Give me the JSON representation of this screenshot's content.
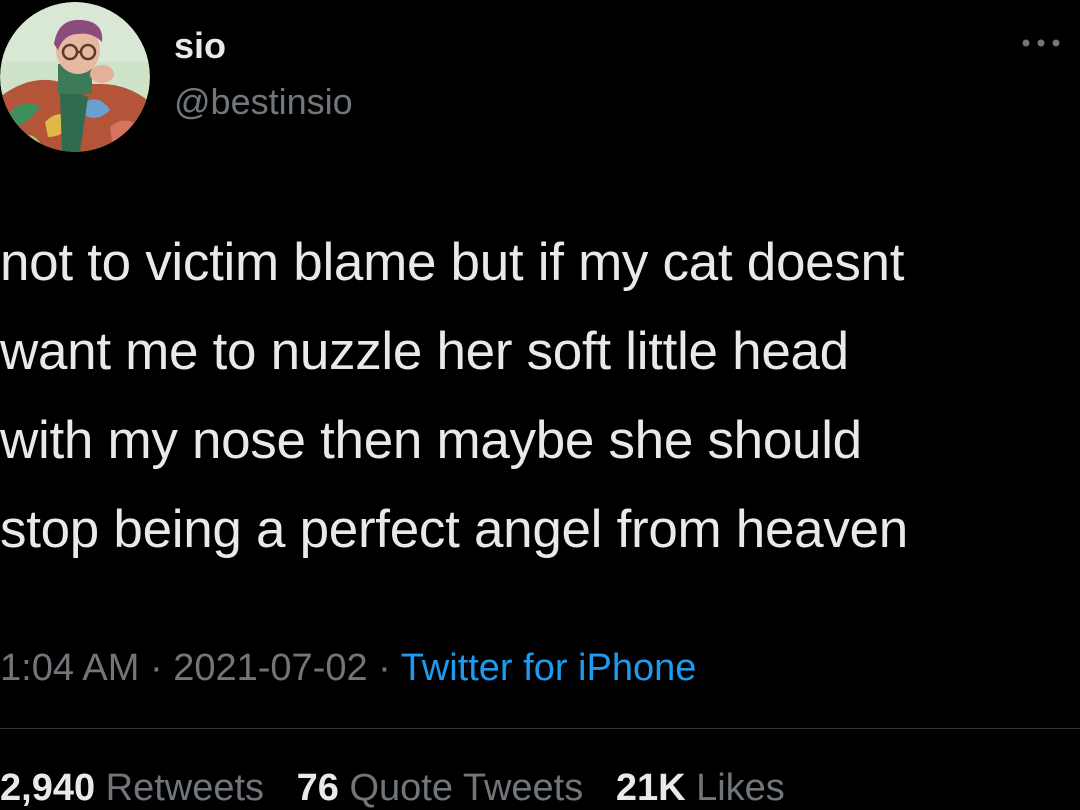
{
  "author": {
    "display_name": "sio",
    "handle": "@bestinsio"
  },
  "tweet": {
    "lines": [
      "not to victim blame but if my cat doesnt",
      "want me to nuzzle her soft little head",
      "with my nose then maybe she should",
      "stop being a perfect angel from heaven"
    ]
  },
  "meta": {
    "time": "1:04 AM",
    "date": "2021-07-02",
    "separator": "·",
    "source": "Twitter for iPhone"
  },
  "stats": {
    "retweets_count": "2,940",
    "retweets_label": "Retweets",
    "quotes_count": "76",
    "quotes_label": "Quote Tweets",
    "likes_count": "21K",
    "likes_label": "Likes"
  },
  "colors": {
    "background": "#000000",
    "text_primary": "#e7e9ea",
    "text_secondary": "#71767b",
    "link": "#1d9bf0"
  },
  "icons": {
    "more": "more-options-icon"
  }
}
